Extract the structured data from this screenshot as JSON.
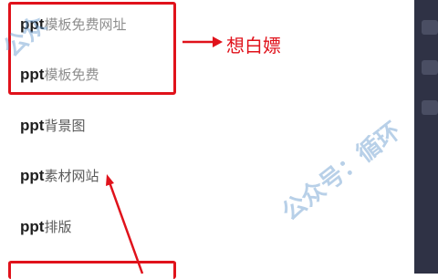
{
  "list": {
    "keyword": "ppt",
    "items": [
      {
        "rest": "模板免费网址"
      },
      {
        "rest": "模板免费"
      },
      {
        "rest": "背景图"
      },
      {
        "rest": "素材网站"
      },
      {
        "rest": "排版"
      }
    ]
  },
  "annotation": {
    "note": "想白嫖",
    "color": "#e0121b"
  },
  "watermark": {
    "left_fragment": "公众",
    "right_text": "公众号：循环"
  },
  "icons": [
    "right-arrow",
    "diagonal-arrow"
  ]
}
